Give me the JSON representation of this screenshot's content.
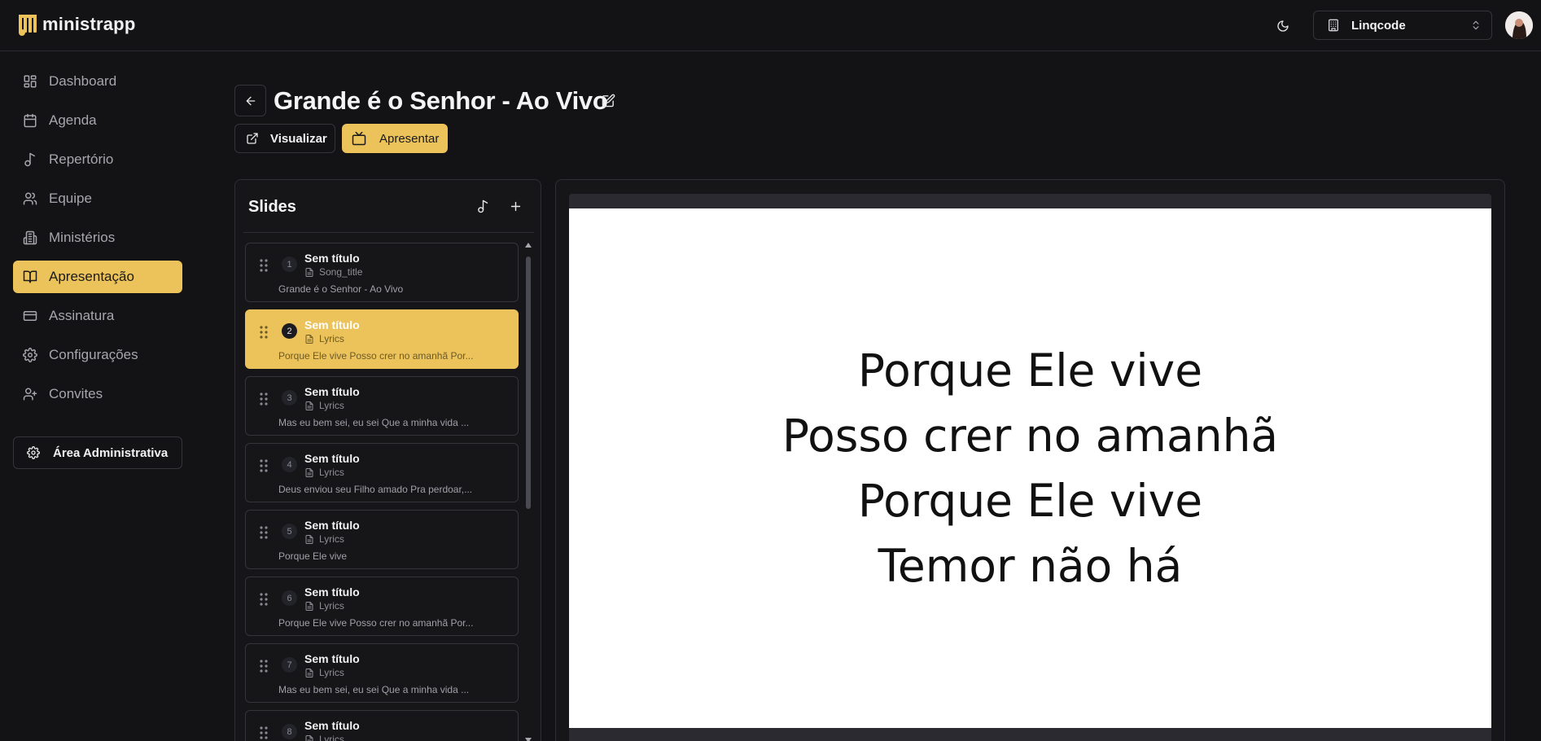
{
  "app": {
    "name": "ministrapp"
  },
  "topbar": {
    "org_name": "Linqcode"
  },
  "sidebar": {
    "items": [
      {
        "label": "Dashboard",
        "icon": "dashboard-icon"
      },
      {
        "label": "Agenda",
        "icon": "calendar-icon"
      },
      {
        "label": "Repertório",
        "icon": "music-note-icon"
      },
      {
        "label": "Equipe",
        "icon": "users-icon"
      },
      {
        "label": "Ministérios",
        "icon": "building-icon"
      },
      {
        "label": "Apresentação",
        "icon": "book-open-icon",
        "active": true
      },
      {
        "label": "Assinatura",
        "icon": "credit-card-icon"
      },
      {
        "label": "Configurações",
        "icon": "gear-icon"
      },
      {
        "label": "Convites",
        "icon": "user-plus-icon"
      }
    ],
    "admin_label": "Área Administrativa"
  },
  "page": {
    "title": "Grande é o Senhor - Ao Vivo",
    "view_label": "Visualizar",
    "present_label": "Apresentar"
  },
  "slides": {
    "heading": "Slides",
    "items": [
      {
        "num": "1",
        "title": "Sem título",
        "type": "Song_title",
        "preview": "Grande é o Senhor - Ao Vivo"
      },
      {
        "num": "2",
        "title": "Sem título",
        "type": "Lyrics",
        "preview": "Porque Ele vive Posso crer no amanhã Por...",
        "active": true
      },
      {
        "num": "3",
        "title": "Sem título",
        "type": "Lyrics",
        "preview": "Mas eu bem sei, eu sei Que a minha vida ..."
      },
      {
        "num": "4",
        "title": "Sem título",
        "type": "Lyrics",
        "preview": "Deus enviou seu Filho amado Pra perdoar,..."
      },
      {
        "num": "5",
        "title": "Sem título",
        "type": "Lyrics",
        "preview": "Porque Ele vive"
      },
      {
        "num": "6",
        "title": "Sem título",
        "type": "Lyrics",
        "preview": "Porque Ele vive Posso crer no amanhã Por..."
      },
      {
        "num": "7",
        "title": "Sem título",
        "type": "Lyrics",
        "preview": "Mas eu bem sei, eu sei Que a minha vida ..."
      },
      {
        "num": "8",
        "title": "Sem título",
        "type": "Lyrics",
        "preview": ""
      }
    ]
  },
  "preview": {
    "lines": [
      "Porque Ele vive",
      "Posso crer no amanhã",
      "Porque Ele vive",
      "Temor não há"
    ]
  },
  "colors": {
    "accent": "#ecc35a",
    "background": "#131316"
  }
}
